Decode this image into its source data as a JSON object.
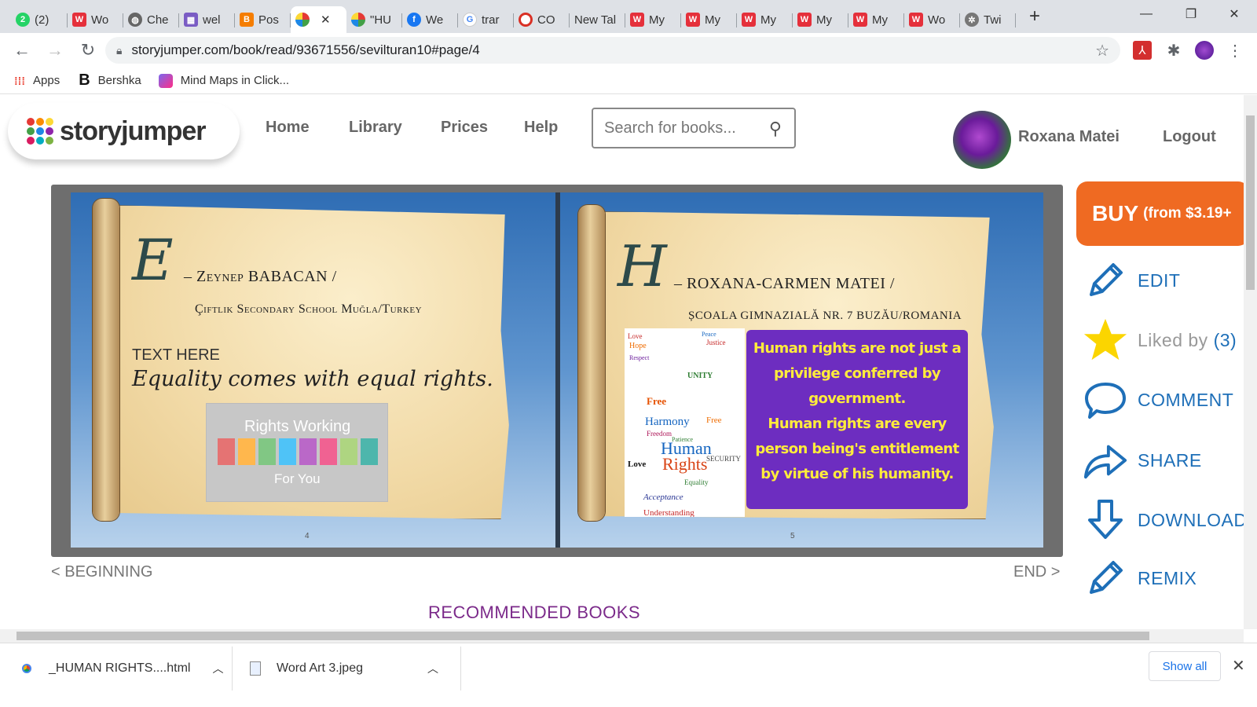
{
  "browser": {
    "tabs": [
      {
        "label": "(2)",
        "icon": "whatsapp-icon",
        "color": "#25d366"
      },
      {
        "label": "Wo",
        "icon": "w-icon",
        "color": "#e5303b"
      },
      {
        "label": "Che",
        "icon": "globe-icon",
        "color": "#555555"
      },
      {
        "label": "wel",
        "icon": "image-icon",
        "color": "#7a5cc4"
      },
      {
        "label": "Pos",
        "icon": "blogger-icon",
        "color": "#f57d00"
      },
      {
        "label": "",
        "icon": "storyjumper-icon",
        "color": "#e53935",
        "active": true
      },
      {
        "label": "\"HU",
        "icon": "storyjumper-icon",
        "color": "#e53935"
      },
      {
        "label": "We",
        "icon": "facebook-icon",
        "color": "#1877f2"
      },
      {
        "label": "trar",
        "icon": "google-icon",
        "color": "#4285f4"
      },
      {
        "label": "CO",
        "icon": "circle-icon",
        "color": "#d93025"
      },
      {
        "label": "New Tal",
        "icon": "",
        "color": ""
      },
      {
        "label": "My",
        "icon": "w-icon",
        "color": "#e5303b"
      },
      {
        "label": "My",
        "icon": "w-icon",
        "color": "#e5303b"
      },
      {
        "label": "My",
        "icon": "w-icon",
        "color": "#e5303b"
      },
      {
        "label": "My",
        "icon": "w-icon",
        "color": "#e5303b"
      },
      {
        "label": "My",
        "icon": "w-icon",
        "color": "#e5303b"
      },
      {
        "label": "Wo",
        "icon": "w-icon",
        "color": "#e5303b"
      },
      {
        "label": "Twi",
        "icon": "gear-icon",
        "color": "#555555"
      }
    ],
    "url": "storyjumper.com/book/read/93671556/sevilturan10#page/4",
    "bookmarks": [
      {
        "label": "Apps",
        "icon": "apps-icon"
      },
      {
        "label": "Bershka",
        "icon": "b-icon"
      },
      {
        "label": "Mind Maps in Click...",
        "icon": "clickup-icon"
      }
    ]
  },
  "site": {
    "logo_text": "storyjumper",
    "nav": [
      "Home",
      "Library",
      "Prices",
      "Help"
    ],
    "search_placeholder": "Search for books...",
    "user_name": "Roxana Matei",
    "logout": "Logout"
  },
  "book": {
    "left_page": {
      "letter": "E",
      "author": "– Zeynep BABACAN /",
      "school": "Çiftlik Secondary School Muğla/Turkey",
      "text_here": "TEXT HERE",
      "quote": "Equality comes with equal rights.",
      "image_title": "Rights Working",
      "image_subtitle": "For You",
      "page_number": "4"
    },
    "right_page": {
      "letter": "H",
      "author": "– ROXANA-CARMEN MATEI /",
      "school": "ȘCOALA GIMNAZIALĂ NR. 7 BUZĂU/ROMANIA",
      "message_line1": "Human rights are not just a",
      "message_line2": "privilege conferred by",
      "message_line3": "government.",
      "message_line4": "Human rights are every",
      "message_line5": "person being's entitlement",
      "message_line6": "by virtue of his humanity.",
      "page_number": "5",
      "word_art": [
        "Love",
        "Hope",
        "Peace",
        "Justice",
        "Respect",
        "Free",
        "UNITY",
        "Harmony",
        "Freedom",
        "Patience",
        "Human",
        "Rights",
        "SECURITY",
        "Acceptance",
        "Understanding",
        "Equality",
        "Love",
        "Free"
      ]
    },
    "beginning": "< BEGINNING",
    "end": "END >",
    "recommended": "RECOMMENDED BOOKS"
  },
  "actions": {
    "buy_label": "BUY",
    "buy_price": "(from $3.19+",
    "edit": "EDIT",
    "liked_by": "Liked by",
    "liked_count": "(3)",
    "comment": "COMMENT",
    "share": "SHARE",
    "download": "DOWNLOAD",
    "remix": "REMIX"
  },
  "downloads": {
    "items": [
      {
        "name": "_HUMAN RIGHTS....html",
        "icon": "chrome-icon"
      },
      {
        "name": "Word Art 3.jpeg",
        "icon": "file-icon"
      }
    ],
    "show_all": "Show all"
  },
  "colors": {
    "accent_blue": "#1e6fb8",
    "buy_orange": "#ef6a22",
    "purple_box": "#6d2dc0",
    "yellow_text": "#ffec3b"
  }
}
